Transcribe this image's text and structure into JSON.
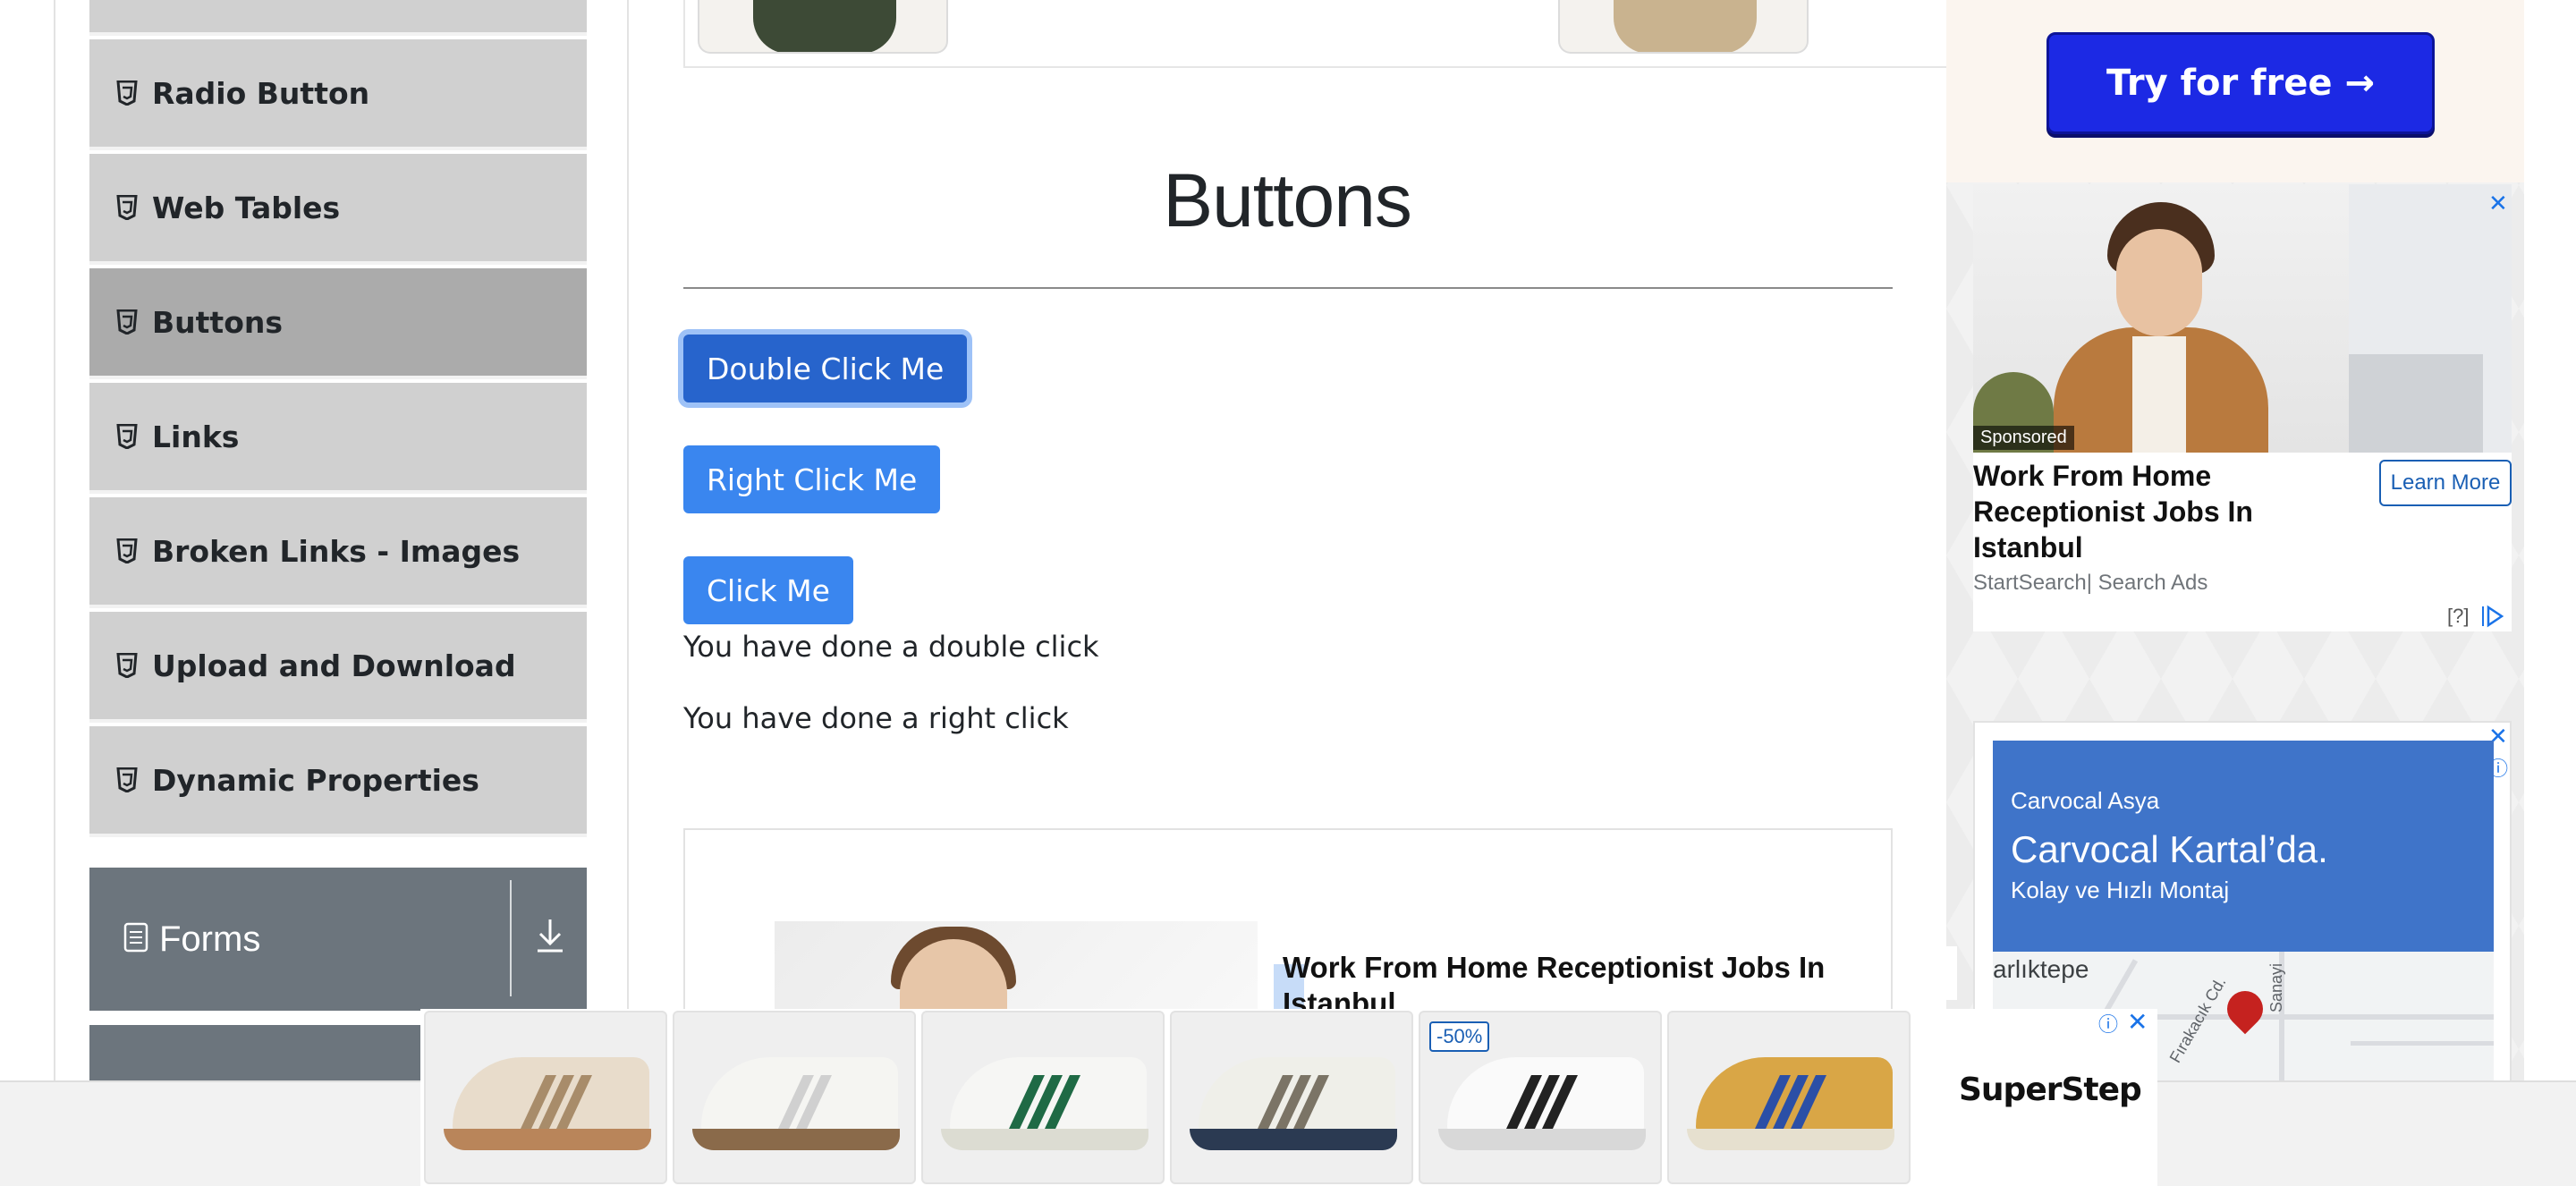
{
  "sidebar": {
    "items": [
      {
        "label": "Radio Button"
      },
      {
        "label": "Web Tables"
      },
      {
        "label": "Buttons"
      },
      {
        "label": "Links"
      },
      {
        "label": "Broken Links - Images"
      },
      {
        "label": "Upload and Download"
      },
      {
        "label": "Dynamic Properties"
      }
    ],
    "active_index": 2,
    "group": {
      "label": "Forms",
      "icon": "document-icon",
      "toggle_icon": "download-arrow-icon"
    }
  },
  "main": {
    "title": "Buttons",
    "buttons": {
      "double_click": "Double Click Me",
      "right_click": "Right Click Me",
      "click": "Click Me"
    },
    "messages": {
      "double_click": "You have done a double click",
      "right_click": "You have done a right click"
    },
    "inline_ad": {
      "headline": "Work From Home Receptionist Jobs In Istanbul"
    }
  },
  "side_ads": {
    "try_button": "Try for free →",
    "ad1": {
      "badge": "Sponsored",
      "headline": "Work From Home Receptionist Jobs In Istanbul",
      "cta": "Learn More",
      "source": "StartSearch| Search Ads",
      "help": "[?]",
      "close": "✕"
    },
    "ad2": {
      "brand": "Carvocal Asya",
      "title": "Carvocal Kartal’da.",
      "subtitle": "Kolay ve Hızlı Montaj",
      "map_place": "arlıktepe",
      "street1": "Fırakacık Cd.",
      "street2": "Sanayi",
      "close": "✕",
      "info": "ⓘ"
    }
  },
  "bottom_ad": {
    "discount_badge": "-50%",
    "brand": "SuperStep",
    "close": "✕",
    "info": "ⓘ",
    "shoes": [
      {
        "name": "beige-gum-sneaker"
      },
      {
        "name": "white-velcro-sneaker"
      },
      {
        "name": "white-green-sneaker"
      },
      {
        "name": "white-grey-runner"
      },
      {
        "name": "white-black-stripe-sneaker"
      },
      {
        "name": "yellow-blue-runner"
      }
    ]
  },
  "colors": {
    "primary_button": "#3a86ef",
    "primary_button_focused": "#2764cc",
    "menu_bg": "#d0d0d0",
    "menu_active_bg": "#ababab",
    "group_header_bg": "#6c757d",
    "try_button_bg": "#1c29e4"
  }
}
